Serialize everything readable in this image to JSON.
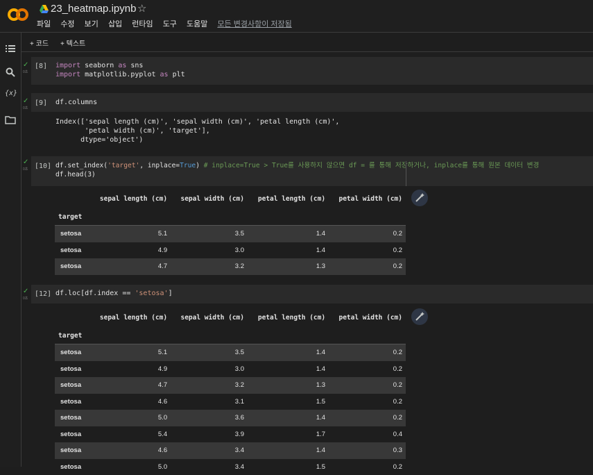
{
  "header": {
    "title": "23_heatmap.ipynb",
    "menu": [
      "파일",
      "수정",
      "보기",
      "삽입",
      "런타임",
      "도구",
      "도움말"
    ],
    "saved_status": "모든 변경사항이 저장됨"
  },
  "toolbar": {
    "add_code": "+ 코드",
    "add_text": "+ 텍스트"
  },
  "sidebar_icons": [
    "toc-icon",
    "search-icon",
    "variables-icon",
    "folder-icon"
  ],
  "cells": [
    {
      "count": "[8]",
      "lines": [
        "import seaborn as sns",
        "import matplotlib.pyplot as plt"
      ]
    },
    {
      "count": "[9]",
      "lines": [
        "df.columns"
      ],
      "output": "Index(['sepal length (cm)', 'sepal width (cm)', 'petal length (cm)',\n       'petal width (cm)', 'target'],\n      dtype='object')"
    },
    {
      "count": "[10]",
      "lines": [
        "df.set_index('target', inplace=True) # inplace=True > True를 사용하지 않으면 df = 를 통해 저장하거나, inplace를 통해 원본 데이터 변경",
        "df.head(3)"
      ]
    },
    {
      "count": "[12]",
      "lines": [
        "df.loc[df.index == 'setosa']"
      ]
    }
  ],
  "run_sub_label": "0초",
  "table_columns": [
    "sepal length (cm)",
    "sepal width (cm)",
    "petal length (cm)",
    "petal width (cm)"
  ],
  "index_name": "target",
  "table1_rows": [
    [
      "setosa",
      "5.1",
      "3.5",
      "1.4",
      "0.2"
    ],
    [
      "setosa",
      "4.9",
      "3.0",
      "1.4",
      "0.2"
    ],
    [
      "setosa",
      "4.7",
      "3.2",
      "1.3",
      "0.2"
    ]
  ],
  "table2_rows": [
    [
      "setosa",
      "5.1",
      "3.5",
      "1.4",
      "0.2"
    ],
    [
      "setosa",
      "4.9",
      "3.0",
      "1.4",
      "0.2"
    ],
    [
      "setosa",
      "4.7",
      "3.2",
      "1.3",
      "0.2"
    ],
    [
      "setosa",
      "4.6",
      "3.1",
      "1.5",
      "0.2"
    ],
    [
      "setosa",
      "5.0",
      "3.6",
      "1.4",
      "0.2"
    ],
    [
      "setosa",
      "5.4",
      "3.9",
      "1.7",
      "0.4"
    ],
    [
      "setosa",
      "4.6",
      "3.4",
      "1.4",
      "0.3"
    ],
    [
      "setosa",
      "5.0",
      "3.4",
      "1.5",
      "0.2"
    ]
  ],
  "colors": {
    "accent_orange": "#f9ab00",
    "check_green": "#4caf50",
    "keyword": "#c586c0",
    "string": "#ce9178",
    "comment": "#6a9955"
  }
}
